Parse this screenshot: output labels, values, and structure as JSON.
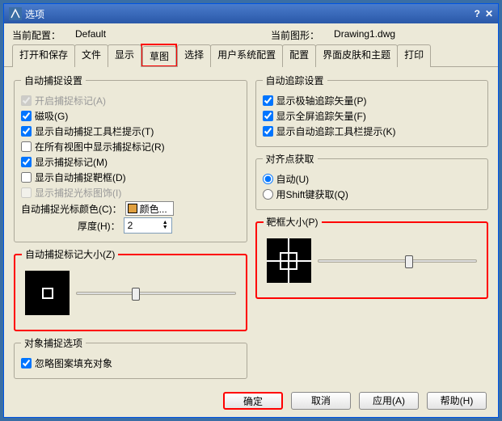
{
  "window": {
    "title": "选项"
  },
  "current_profile_label": "当前配置：",
  "current_profile_value": "Default",
  "current_drawing_label": "当前图形：",
  "current_drawing_value": "Drawing1.dwg",
  "tabs": {
    "t0": "打开和保存",
    "t1": "文件",
    "t2": "显示",
    "t3": "草图",
    "t4": "选择",
    "t5": "用户系统配置",
    "t6": "配置",
    "t7": "界面皮肤和主题",
    "t8": "打印"
  },
  "autosnap": {
    "legend": "自动捕捉设置",
    "enable_marker": "开启捕捉标记(A)",
    "magnet": "磁吸(G)",
    "tooltip": "显示自动捕捉工具栏提示(T)",
    "all_views": "在所有视图中显示捕捉标记(R)",
    "marker": "显示捕捉标记(M)",
    "aperture_box": "显示自动捕捉靶框(D)",
    "cursor_deco": "显示捕捉光标图饰(I)",
    "color_label": "自动捕捉光标颜色(C)：",
    "color_button": "颜色...",
    "thickness_label": "厚度(H)：",
    "thickness_value": "2"
  },
  "autotrack": {
    "legend": "自动追踪设置",
    "polar": "显示极轴追踪矢量(P)",
    "fullscreen": "显示全屏追踪矢量(F)",
    "tooltip": "显示自动追踪工具栏提示(K)"
  },
  "alignpoint": {
    "legend": "对齐点获取",
    "auto": "自动(U)",
    "shift": "用Shift键获取(Q)"
  },
  "marker_size": {
    "legend": "自动捕捉标记大小(Z)"
  },
  "aperture_size": {
    "legend": "靶框大小(P)"
  },
  "osnap_options": {
    "legend": "对象捕捉选项",
    "ignore_hatch": "忽略图案填充对象"
  },
  "buttons": {
    "ok": "确定",
    "cancel": "取消",
    "apply": "应用(A)",
    "help": "帮助(H)"
  }
}
